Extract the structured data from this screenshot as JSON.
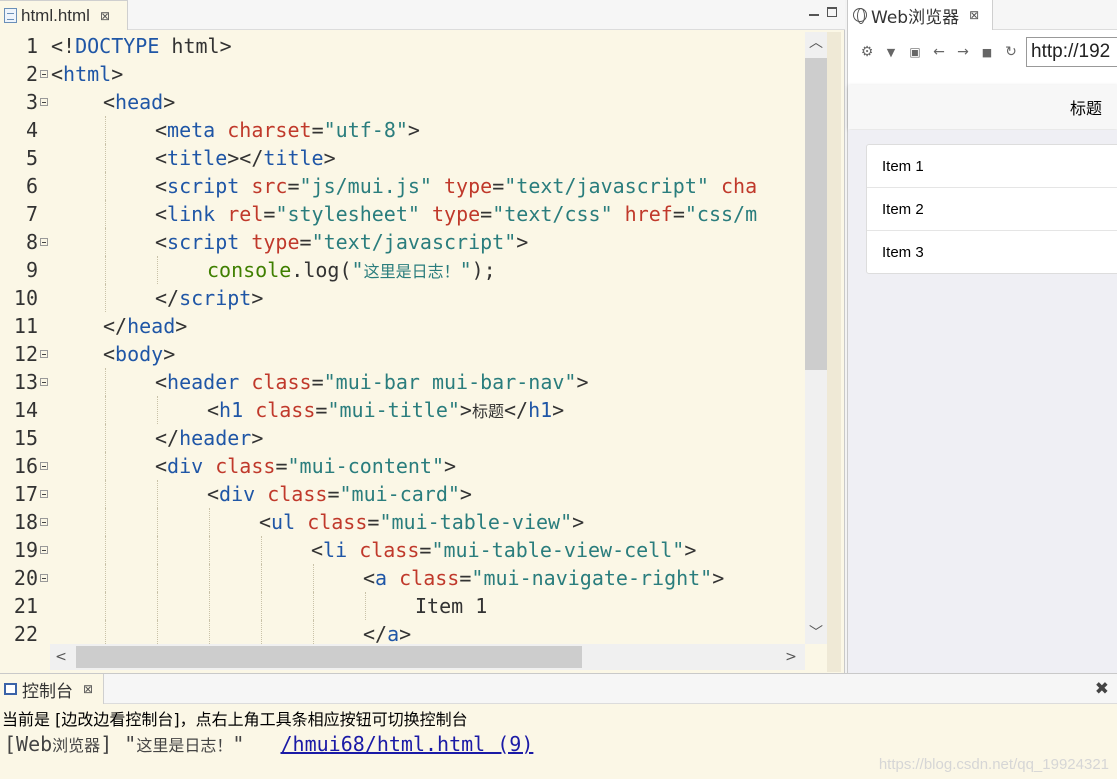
{
  "editor": {
    "tab_label": "html.html",
    "tab_close": "⊠",
    "lines": [
      {
        "n": "1",
        "indent": 0,
        "fold": false,
        "parts": [
          [
            "p",
            "<!"
          ],
          [
            "t",
            "DOCTYPE"
          ],
          [
            "p",
            " html>"
          ]
        ]
      },
      {
        "n": "2",
        "indent": 0,
        "fold": true,
        "parts": [
          [
            "p",
            "<"
          ],
          [
            "t",
            "html"
          ],
          [
            "p",
            ">"
          ]
        ]
      },
      {
        "n": "3",
        "indent": 1,
        "fold": true,
        "parts": [
          [
            "p",
            "<"
          ],
          [
            "t",
            "head"
          ],
          [
            "p",
            ">"
          ]
        ]
      },
      {
        "n": "4",
        "indent": 2,
        "fold": false,
        "parts": [
          [
            "p",
            "<"
          ],
          [
            "t",
            "meta"
          ],
          [
            "p",
            " "
          ],
          [
            "a",
            "charset"
          ],
          [
            "p",
            "="
          ],
          [
            "s",
            "\"utf-8\""
          ],
          [
            "p",
            ">"
          ]
        ]
      },
      {
        "n": "5",
        "indent": 2,
        "fold": false,
        "parts": [
          [
            "p",
            "<"
          ],
          [
            "t",
            "title"
          ],
          [
            "p",
            "></"
          ],
          [
            "t",
            "title"
          ],
          [
            "p",
            ">"
          ]
        ]
      },
      {
        "n": "6",
        "indent": 2,
        "fold": false,
        "parts": [
          [
            "p",
            "<"
          ],
          [
            "t",
            "script"
          ],
          [
            "p",
            " "
          ],
          [
            "a",
            "src"
          ],
          [
            "p",
            "="
          ],
          [
            "s",
            "\"js/mui.js\""
          ],
          [
            "p",
            " "
          ],
          [
            "a",
            "type"
          ],
          [
            "p",
            "="
          ],
          [
            "s",
            "\"text/javascript\""
          ],
          [
            "p",
            " "
          ],
          [
            "a",
            "cha"
          ]
        ]
      },
      {
        "n": "7",
        "indent": 2,
        "fold": false,
        "parts": [
          [
            "p",
            "<"
          ],
          [
            "t",
            "link"
          ],
          [
            "p",
            " "
          ],
          [
            "a",
            "rel"
          ],
          [
            "p",
            "="
          ],
          [
            "s",
            "\"stylesheet\""
          ],
          [
            "p",
            " "
          ],
          [
            "a",
            "type"
          ],
          [
            "p",
            "="
          ],
          [
            "s",
            "\"text/css\""
          ],
          [
            "p",
            " "
          ],
          [
            "a",
            "href"
          ],
          [
            "p",
            "="
          ],
          [
            "s",
            "\"css/m"
          ]
        ]
      },
      {
        "n": "8",
        "indent": 2,
        "fold": true,
        "parts": [
          [
            "p",
            "<"
          ],
          [
            "t",
            "script"
          ],
          [
            "p",
            " "
          ],
          [
            "a",
            "type"
          ],
          [
            "p",
            "="
          ],
          [
            "s",
            "\"text/javascript\""
          ],
          [
            "p",
            ">"
          ]
        ]
      },
      {
        "n": "9",
        "indent": 3,
        "fold": false,
        "parts": [
          [
            "fn",
            "console"
          ],
          [
            "p",
            ".log("
          ],
          [
            "s",
            "\""
          ],
          [
            "scj",
            "这里是日志！"
          ],
          [
            "s",
            "\""
          ],
          [
            "p",
            ");"
          ]
        ]
      },
      {
        "n": "10",
        "indent": 2,
        "fold": false,
        "parts": [
          [
            "p",
            "</"
          ],
          [
            "t",
            "script"
          ],
          [
            "p",
            ">"
          ]
        ]
      },
      {
        "n": "11",
        "indent": 1,
        "fold": false,
        "parts": [
          [
            "p",
            "</"
          ],
          [
            "t",
            "head"
          ],
          [
            "p",
            ">"
          ]
        ]
      },
      {
        "n": "12",
        "indent": 1,
        "fold": true,
        "parts": [
          [
            "p",
            "<"
          ],
          [
            "t",
            "body"
          ],
          [
            "p",
            ">"
          ]
        ]
      },
      {
        "n": "13",
        "indent": 2,
        "fold": true,
        "parts": [
          [
            "p",
            "<"
          ],
          [
            "t",
            "header"
          ],
          [
            "p",
            " "
          ],
          [
            "a",
            "class"
          ],
          [
            "p",
            "="
          ],
          [
            "s",
            "\"mui-bar mui-bar-nav\""
          ],
          [
            "p",
            ">"
          ]
        ]
      },
      {
        "n": "14",
        "indent": 3,
        "fold": false,
        "parts": [
          [
            "p",
            "<"
          ],
          [
            "t",
            "h1"
          ],
          [
            "p",
            " "
          ],
          [
            "a",
            "class"
          ],
          [
            "p",
            "="
          ],
          [
            "s",
            "\"mui-title\""
          ],
          [
            "p",
            ">"
          ],
          [
            "pcj",
            "标题"
          ],
          [
            "p",
            "</"
          ],
          [
            "t",
            "h1"
          ],
          [
            "p",
            ">"
          ]
        ]
      },
      {
        "n": "15",
        "indent": 2,
        "fold": false,
        "parts": [
          [
            "p",
            "</"
          ],
          [
            "t",
            "header"
          ],
          [
            "p",
            ">"
          ]
        ]
      },
      {
        "n": "16",
        "indent": 2,
        "fold": true,
        "parts": [
          [
            "p",
            "<"
          ],
          [
            "t",
            "div"
          ],
          [
            "p",
            " "
          ],
          [
            "a",
            "class"
          ],
          [
            "p",
            "="
          ],
          [
            "s",
            "\"mui-content\""
          ],
          [
            "p",
            ">"
          ]
        ]
      },
      {
        "n": "17",
        "indent": 3,
        "fold": true,
        "parts": [
          [
            "p",
            "<"
          ],
          [
            "t",
            "div"
          ],
          [
            "p",
            " "
          ],
          [
            "a",
            "class"
          ],
          [
            "p",
            "="
          ],
          [
            "s",
            "\"mui-card\""
          ],
          [
            "p",
            ">"
          ]
        ]
      },
      {
        "n": "18",
        "indent": 4,
        "fold": true,
        "parts": [
          [
            "p",
            "<"
          ],
          [
            "t",
            "ul"
          ],
          [
            "p",
            " "
          ],
          [
            "a",
            "class"
          ],
          [
            "p",
            "="
          ],
          [
            "s",
            "\"mui-table-view\""
          ],
          [
            "p",
            ">"
          ]
        ]
      },
      {
        "n": "19",
        "indent": 5,
        "fold": true,
        "parts": [
          [
            "p",
            "<"
          ],
          [
            "t",
            "li"
          ],
          [
            "p",
            " "
          ],
          [
            "a",
            "class"
          ],
          [
            "p",
            "="
          ],
          [
            "s",
            "\"mui-table-view-cell\""
          ],
          [
            "p",
            ">"
          ]
        ]
      },
      {
        "n": "20",
        "indent": 6,
        "fold": true,
        "parts": [
          [
            "p",
            "<"
          ],
          [
            "t",
            "a"
          ],
          [
            "p",
            " "
          ],
          [
            "a",
            "class"
          ],
          [
            "p",
            "="
          ],
          [
            "s",
            "\"mui-navigate-right\""
          ],
          [
            "p",
            ">"
          ]
        ]
      },
      {
        "n": "21",
        "indent": 7,
        "fold": false,
        "parts": [
          [
            "p",
            "Item 1"
          ]
        ]
      },
      {
        "n": "22",
        "indent": 6,
        "fold": false,
        "parts": [
          [
            "p",
            "</"
          ],
          [
            "t",
            "a"
          ],
          [
            "p",
            ">"
          ]
        ]
      }
    ]
  },
  "browser": {
    "tab_label": "Web浏览器",
    "tab_close": "⊠",
    "url": "http://192",
    "header_title": "标题",
    "items": [
      "Item 1",
      "Item 2",
      "Item 3"
    ]
  },
  "console": {
    "tab_label": "控制台",
    "tab_close": "⊠",
    "message": "当前是 [边改边看控制台]，点右上角工具条相应按钮可切换控制台",
    "log_prefix": "[Web",
    "log_prefix_cj": "浏览器",
    "log_mid": "] \"",
    "log_text_cj": "这里是日志！",
    "log_end": "\"   ",
    "log_link": "/hmui68/html.html (9)",
    "watermark": "https://blog.csdn.net/qq_19924321"
  },
  "colors": {
    "tag": "#1f56a6",
    "attribute": "#c0392b",
    "string": "#2a7d7d",
    "function": "#3f7f00",
    "editor_bg": "#fbf7e6"
  }
}
